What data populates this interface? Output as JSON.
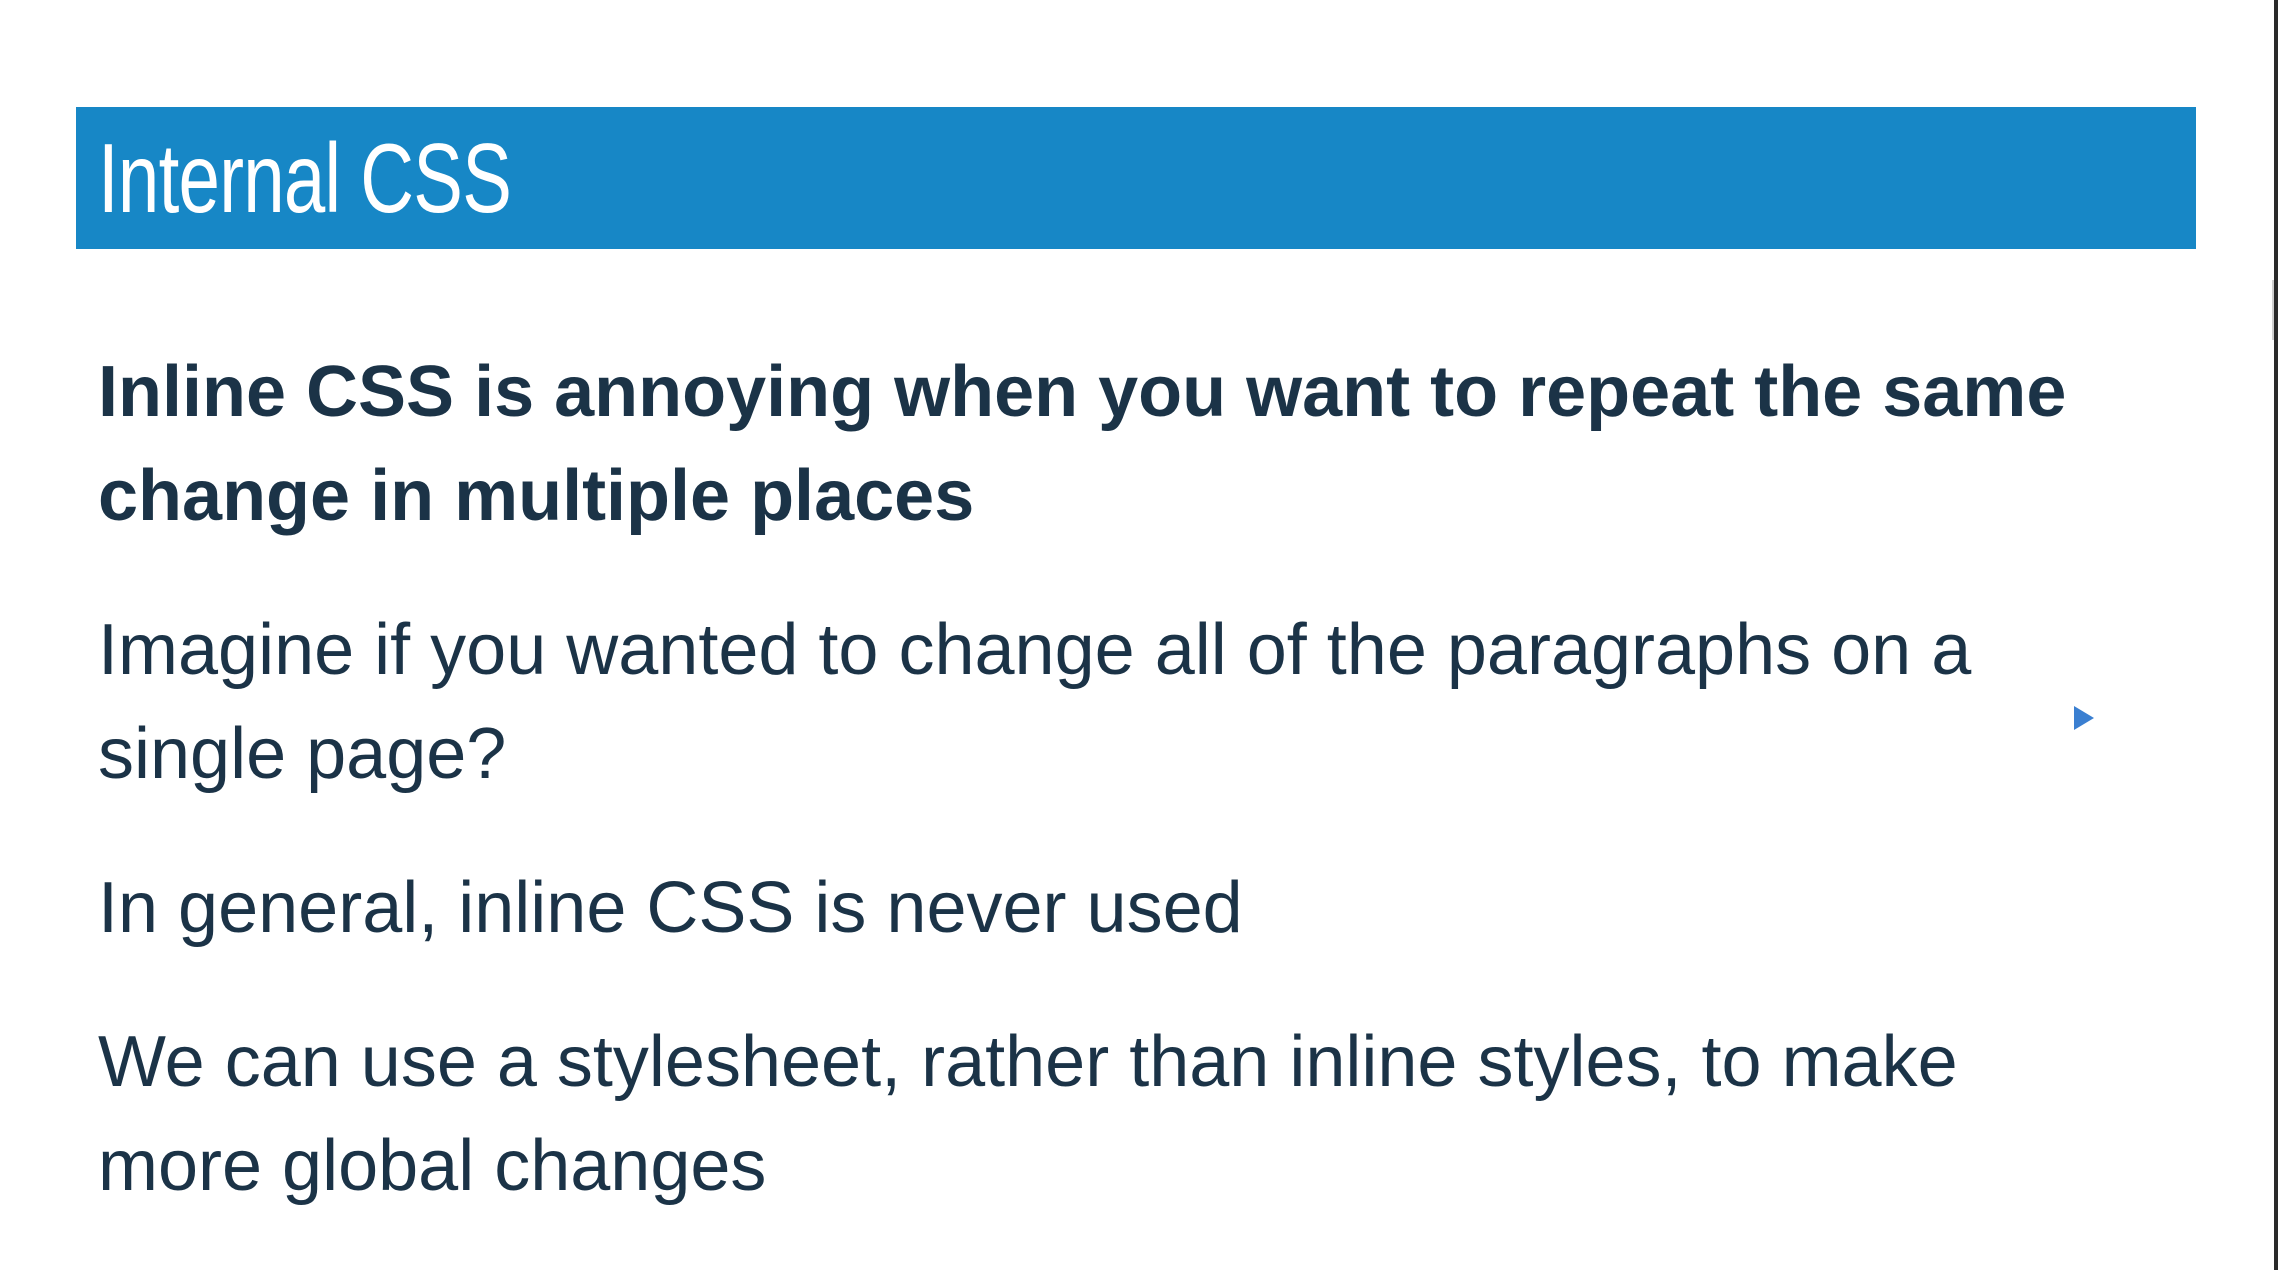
{
  "slide": {
    "title": "Internal CSS",
    "lead": "Inline CSS is annoying when you want to repeat the same change in multiple places",
    "paragraphs": [
      "Imagine if you wanted to change all of the paragraphs on a single page?",
      "In general, inline CSS is never used",
      "We can use a stylesheet, rather than inline styles, to make more global changes"
    ]
  },
  "colors": {
    "title_bar": "#1787c6",
    "title_text": "#ffffff",
    "body_text": "#1b3347",
    "background": "#ffffff"
  },
  "icons": {
    "cursor": "mouse-pointer-icon"
  }
}
